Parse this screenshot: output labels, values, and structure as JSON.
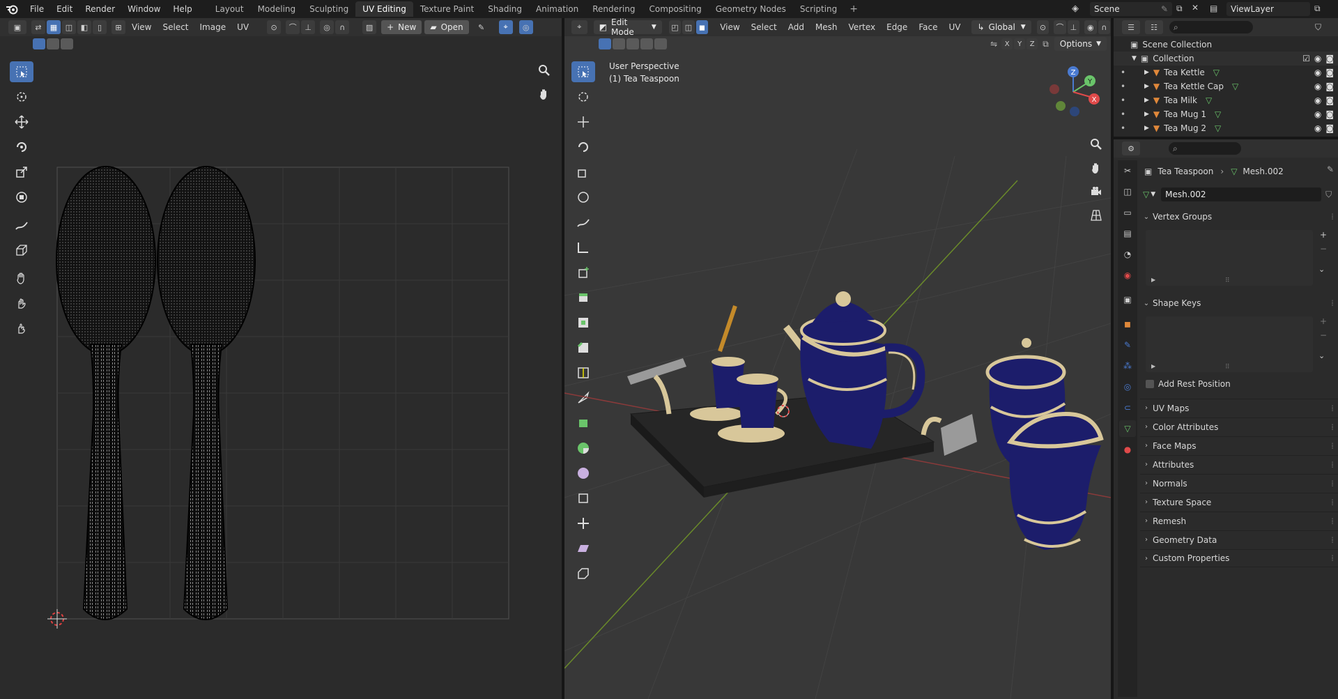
{
  "menu": [
    "File",
    "Edit",
    "Render",
    "Window",
    "Help"
  ],
  "workspaces": [
    {
      "label": "Layout",
      "active": false
    },
    {
      "label": "Modeling",
      "active": false
    },
    {
      "label": "Sculpting",
      "active": false
    },
    {
      "label": "UV Editing",
      "active": true
    },
    {
      "label": "Texture Paint",
      "active": false
    },
    {
      "label": "Shading",
      "active": false
    },
    {
      "label": "Animation",
      "active": false
    },
    {
      "label": "Rendering",
      "active": false
    },
    {
      "label": "Compositing",
      "active": false
    },
    {
      "label": "Geometry Nodes",
      "active": false
    },
    {
      "label": "Scripting",
      "active": false
    }
  ],
  "ws_add": "+",
  "scene": "Scene",
  "view_layer": "ViewLayer",
  "uv_editor": {
    "menus": [
      "View",
      "Select",
      "Image",
      "UV"
    ],
    "new_label": "New",
    "open_label": "Open"
  },
  "viewport": {
    "mode": "Edit Mode",
    "menus": [
      "View",
      "Select",
      "Add",
      "Mesh",
      "Vertex",
      "Edge",
      "Face",
      "UV"
    ],
    "orientation": "Global",
    "options_label": "Options",
    "axes": [
      "X",
      "Y",
      "Z"
    ],
    "overlay_title": "User Perspective",
    "overlay_object": "(1) Tea Teaspoon"
  },
  "outliner": {
    "scene_collection": "Scene Collection",
    "collection": "Collection",
    "items": [
      "Tea Kettle",
      "Tea Kettle Cap",
      "Tea Milk",
      "Tea Mug 1",
      "Tea Mug 2"
    ]
  },
  "properties": {
    "object_name": "Tea Teaspoon",
    "mesh_name": "Mesh.002",
    "mesh_field": "Mesh.002",
    "vertex_groups": "Vertex Groups",
    "shape_keys": "Shape Keys",
    "add_rest_position": "Add Rest Position",
    "panels": [
      "UV Maps",
      "Color Attributes",
      "Face Maps",
      "Attributes",
      "Normals",
      "Texture Space",
      "Remesh",
      "Geometry Data",
      "Custom Properties"
    ]
  },
  "colors": {
    "accent": "#4772b3",
    "mesh_icon": "#6ac46a",
    "object_icon": "#e0883a",
    "kettle_blue": "#1c1d6b",
    "gold_trim": "#d8c79a"
  }
}
